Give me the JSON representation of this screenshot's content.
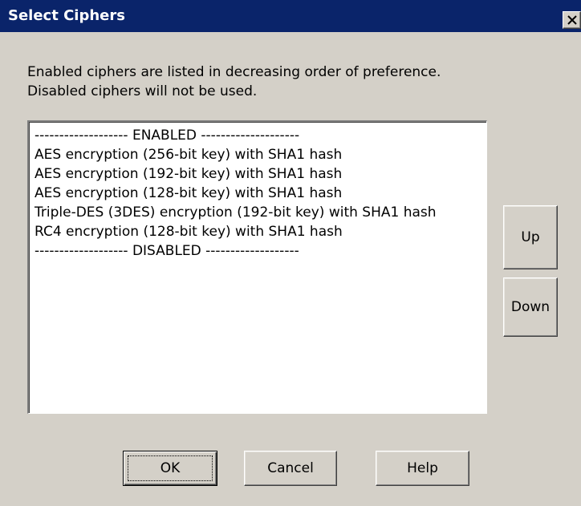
{
  "window": {
    "title": "Select Ciphers",
    "close_icon": "close-icon"
  },
  "description": {
    "line1": "Enabled ciphers are listed in decreasing order of preference.",
    "line2": "Disabled ciphers will not be used."
  },
  "cipher_list": {
    "items": [
      "------------------- ENABLED --------------------",
      "AES encryption (256-bit key) with SHA1 hash",
      "AES encryption (192-bit key) with SHA1 hash",
      "AES encryption (128-bit key) with SHA1 hash",
      "Triple-DES (3DES) encryption (192-bit key) with SHA1 hash",
      "RC4 encryption (128-bit key) with SHA1 hash",
      "------------------- DISABLED -------------------"
    ]
  },
  "side_buttons": {
    "up_label": "Up",
    "down_label": "Down"
  },
  "footer_buttons": {
    "ok_label": "OK",
    "cancel_label": "Cancel",
    "help_label": "Help"
  },
  "colors": {
    "titlebar": "#0a246a",
    "dialog_face": "#d4d0c8",
    "list_background": "#ffffff"
  }
}
